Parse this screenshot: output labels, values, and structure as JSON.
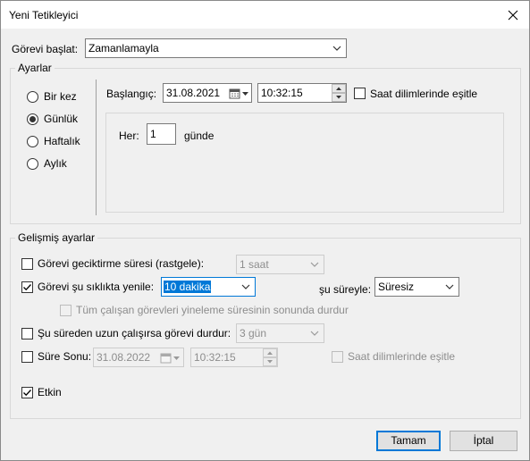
{
  "window": {
    "title": "Yeni Tetikleyici"
  },
  "start_task": {
    "label": "Görevi başlat:",
    "value": "Zamanlamayla"
  },
  "settings": {
    "legend": "Ayarlar",
    "schedule_types": [
      "Bir kez",
      "Günlük",
      "Haftalık",
      "Aylık"
    ],
    "selected_schedule": "Günlük",
    "start_label": "Başlangıç:",
    "start_date": "31.08.2021",
    "start_time": "10:32:15",
    "sync_tz_label": "Saat dilimlerinde eşitle",
    "sync_tz_checked": false,
    "every_label": "Her:",
    "every_value": "1",
    "every_unit": "günde"
  },
  "advanced": {
    "legend": "Gelişmiş ayarlar",
    "delay": {
      "label": "Görevi geciktirme süresi (rastgele):",
      "checked": false,
      "value": "1 saat"
    },
    "repeat": {
      "label": "Görevi şu sıklıkta yenile:",
      "checked": true,
      "value": "10 dakika",
      "duration_label": "şu süreyle:",
      "duration_value": "Süresiz"
    },
    "stop_all": {
      "label": "Tüm çalışan görevleri yineleme süresinin sonunda durdur",
      "checked": false
    },
    "stop_longer": {
      "label": "Şu süreden uzun çalışırsa görevi durdur:",
      "checked": false,
      "value": "3 gün"
    },
    "expire": {
      "label": "Süre Sonu:",
      "checked": false,
      "date": "31.08.2022",
      "time": "10:32:15",
      "sync_label": "Saat dilimlerinde eşitle"
    },
    "enabled": {
      "label": "Etkin",
      "checked": true
    }
  },
  "buttons": {
    "ok": "Tamam",
    "cancel": "İptal"
  },
  "icons": {
    "close": "close-icon",
    "dropdown": "chevron-down-icon",
    "calendar": "calendar-icon",
    "spin": "spin-up-down-icon",
    "check": "checkmark-icon"
  },
  "colors": {
    "accent": "#0078d7",
    "window_bg": "#f0f0f0",
    "disabled_text": "#8d8d8d"
  }
}
